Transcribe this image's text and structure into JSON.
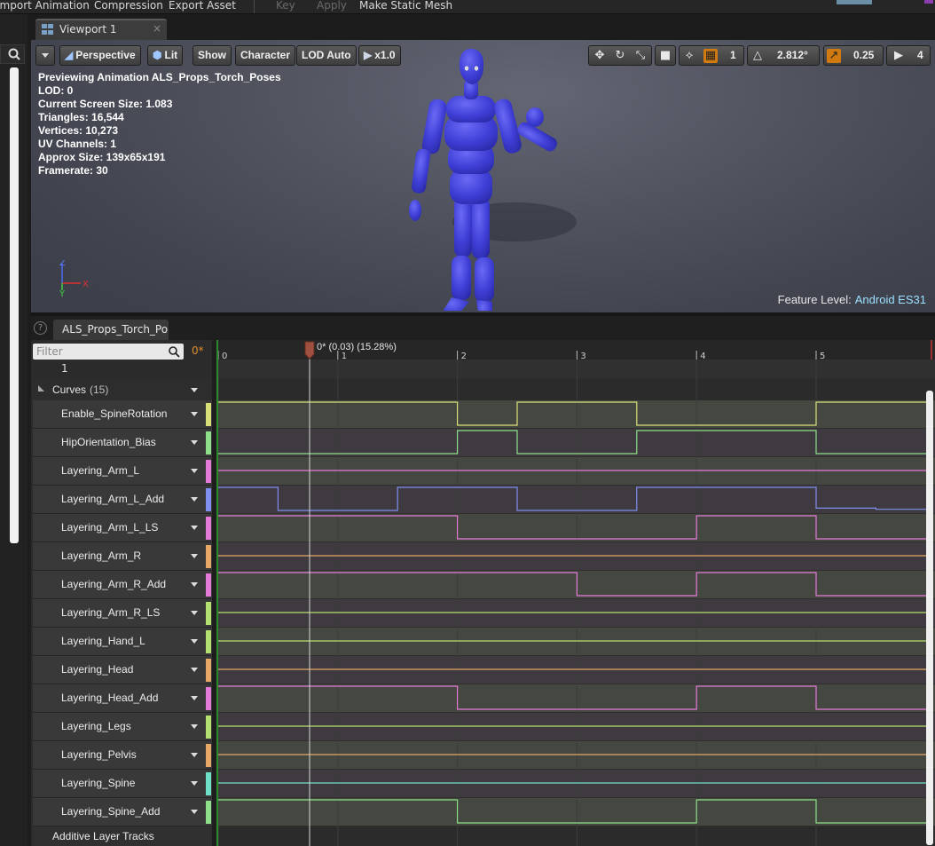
{
  "menubar": {
    "items": [
      {
        "label": "Import Animation",
        "enabled": true
      },
      {
        "label": "Compression",
        "enabled": true
      },
      {
        "label": "Export Asset",
        "enabled": true
      },
      {
        "label": "Key",
        "enabled": false
      },
      {
        "label": "Apply",
        "enabled": false
      },
      {
        "label": "Make Static Mesh",
        "enabled": true
      }
    ]
  },
  "viewport_tab": {
    "label": "Viewport 1",
    "close": "×"
  },
  "viewport_toolbar": {
    "perspective": "Perspective",
    "lit": "Lit",
    "show": "Show",
    "character": "Character",
    "lod": "LOD Auto",
    "speed": "x1.0",
    "grid_snap": "1",
    "rotation_snap": "2.812°",
    "scale_snap": "0.25",
    "camera_speed": "4"
  },
  "stats": [
    "Previewing Animation ALS_Props_Torch_Poses",
    "LOD: 0",
    "Current Screen Size: 1.083",
    "Triangles: 16,544",
    "Vertices: 10,273",
    "UV Channels: 1",
    "Approx Size: 139x65x191",
    "Framerate: 30"
  ],
  "feature_level": {
    "label": "Feature Level:",
    "value": "Android ES31"
  },
  "axes": {
    "z": "Z",
    "y": "Y",
    "x": "X"
  },
  "track_tab": {
    "label": "ALS_Props_Torch_Po"
  },
  "filter": {
    "placeholder": "Filter"
  },
  "current_frame_label": "0*",
  "playhead": {
    "label": "0* (0.03) (15.28%)",
    "position_fraction": 0.1528
  },
  "timeline_ticks": [
    "0",
    "1",
    "2",
    "3",
    "4",
    "5"
  ],
  "row_notify": "1",
  "curves_header": {
    "label": "Curves",
    "count": "(15)"
  },
  "curves": [
    {
      "name": "Enable_SpineRotation",
      "color": "#d9e07a",
      "levels": [
        1,
        1,
        1,
        1,
        0,
        1,
        1,
        0,
        0,
        0,
        1,
        1
      ]
    },
    {
      "name": "HipOrientation_Bias",
      "color": "#8ee08a",
      "levels": [
        0,
        0,
        0,
        0,
        1,
        0,
        0,
        1,
        1,
        1,
        0,
        0
      ]
    },
    {
      "name": "Layering_Arm_L",
      "color": "#e47ad8",
      "levels": [
        0.5,
        0.5,
        0.5,
        0.5,
        0.5,
        0.5,
        0.5,
        0.5,
        0.5,
        0.5,
        0.5,
        0.5
      ]
    },
    {
      "name": "Layering_Arm_L_Add",
      "color": "#7f8ef0",
      "levels": [
        1,
        0,
        0,
        1,
        1,
        0,
        0,
        1,
        1,
        1,
        0.1,
        0.05
      ]
    },
    {
      "name": "Layering_Arm_L_LS",
      "color": "#e47ad8",
      "levels": [
        1,
        1,
        1,
        1,
        0,
        0,
        0,
        0,
        1,
        1,
        0,
        0
      ]
    },
    {
      "name": "Layering_Arm_R",
      "color": "#e8a868",
      "levels": [
        0.5,
        0.5,
        0.5,
        0.5,
        0.5,
        0.5,
        0.5,
        0.5,
        0.5,
        0.5,
        0.5,
        0.5
      ]
    },
    {
      "name": "Layering_Arm_R_Add",
      "color": "#e47ad8",
      "levels": [
        1,
        1,
        1,
        1,
        1,
        1,
        0,
        0,
        1,
        1,
        0,
        0
      ]
    },
    {
      "name": "Layering_Arm_R_LS",
      "color": "#b4e070",
      "levels": [
        0.5,
        0.5,
        0.5,
        0.5,
        0.5,
        0.5,
        0.5,
        0.5,
        0.5,
        0.5,
        0.5,
        0.5
      ]
    },
    {
      "name": "Layering_Hand_L",
      "color": "#b4e070",
      "levels": [
        0.5,
        0.5,
        0.5,
        0.5,
        0.5,
        0.5,
        0.5,
        0.5,
        0.5,
        0.5,
        0.5,
        0.5
      ]
    },
    {
      "name": "Layering_Head",
      "color": "#e8a868",
      "levels": [
        0.5,
        0.5,
        0.5,
        0.5,
        0.5,
        0.5,
        0.5,
        0.5,
        0.5,
        0.5,
        0.5,
        0.5
      ]
    },
    {
      "name": "Layering_Head_Add",
      "color": "#e47ad8",
      "levels": [
        1,
        1,
        1,
        1,
        0,
        0,
        0,
        0,
        1,
        1,
        0,
        0
      ]
    },
    {
      "name": "Layering_Legs",
      "color": "#b4e070",
      "levels": [
        0.5,
        0.5,
        0.5,
        0.5,
        0.5,
        0.5,
        0.5,
        0.5,
        0.5,
        0.5,
        0.5,
        0.5
      ]
    },
    {
      "name": "Layering_Pelvis",
      "color": "#e8a868",
      "levels": [
        0.5,
        0.5,
        0.5,
        0.5,
        0.5,
        0.5,
        0.5,
        0.5,
        0.5,
        0.5,
        0.5,
        0.5
      ]
    },
    {
      "name": "Layering_Spine",
      "color": "#6fe0c8",
      "levels": [
        0.5,
        0.5,
        0.5,
        0.5,
        0.5,
        0.5,
        0.5,
        0.5,
        0.5,
        0.5,
        0.5,
        0.5
      ]
    },
    {
      "name": "Layering_Spine_Add",
      "color": "#8ee08a",
      "levels": [
        1,
        1,
        1,
        1,
        0,
        0,
        0,
        0,
        1,
        1,
        0,
        0
      ]
    }
  ],
  "additive_tracks": "Additive Layer Tracks",
  "colors": {
    "accent_orange": "#d07a10",
    "mannequin": "#3f3fd8",
    "feature_value": "#9ce0ff"
  }
}
